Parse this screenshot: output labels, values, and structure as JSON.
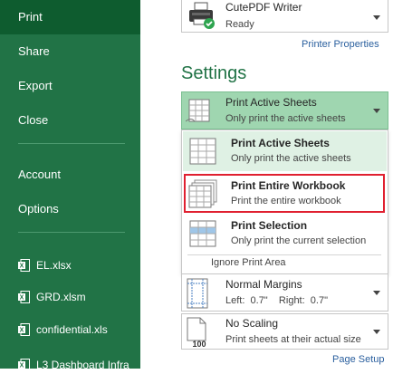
{
  "sidebar": {
    "items": [
      {
        "label": "Print",
        "active": true
      },
      {
        "label": "Share"
      },
      {
        "label": "Export"
      },
      {
        "label": "Close"
      },
      {
        "label": "Account"
      },
      {
        "label": "Options"
      }
    ],
    "recent_files": [
      {
        "label": "EL.xlsx",
        "icon": "excel-file-icon"
      },
      {
        "label": "GRD.xlsm",
        "icon": "excel-file-icon"
      },
      {
        "label": "confidential.xls",
        "icon": "excel-file-icon"
      },
      {
        "label": "L3 Dashboard Infra",
        "icon": "excel-file-icon"
      }
    ]
  },
  "printer": {
    "name": "CutePDF Writer",
    "status": "Ready",
    "properties_link": "Printer Properties",
    "icon": "printer-icon"
  },
  "settings": {
    "title": "Settings",
    "print_what": {
      "title": "Print Active Sheets",
      "subtitle": "Only print the active sheets"
    },
    "options": [
      {
        "title": "Print Active Sheets",
        "subtitle": "Only print the active sheets",
        "highlighted": true
      },
      {
        "title": "Print Entire Workbook",
        "subtitle": "Print the entire workbook",
        "outlined": true
      },
      {
        "title": "Print Selection",
        "subtitle": "Only print the current selection"
      }
    ],
    "ignore_print_area": "Ignore Print Area",
    "margins": {
      "title": "Normal Margins",
      "subtitle": "Left:  0.7\"    Right:  0.7\""
    },
    "scaling": {
      "title": "No Scaling",
      "subtitle": "Print sheets at their actual size",
      "icon_label": "100"
    },
    "page_setup_link": "Page Setup"
  },
  "colors": {
    "sidebar_bg": "#217346",
    "sidebar_active": "#0e5c2f",
    "accent": "#217346",
    "selected_bg": "#9fd6b0",
    "hover_bg": "#dff1e4",
    "outline_red": "#e02030",
    "link": "#2a5f9e"
  }
}
